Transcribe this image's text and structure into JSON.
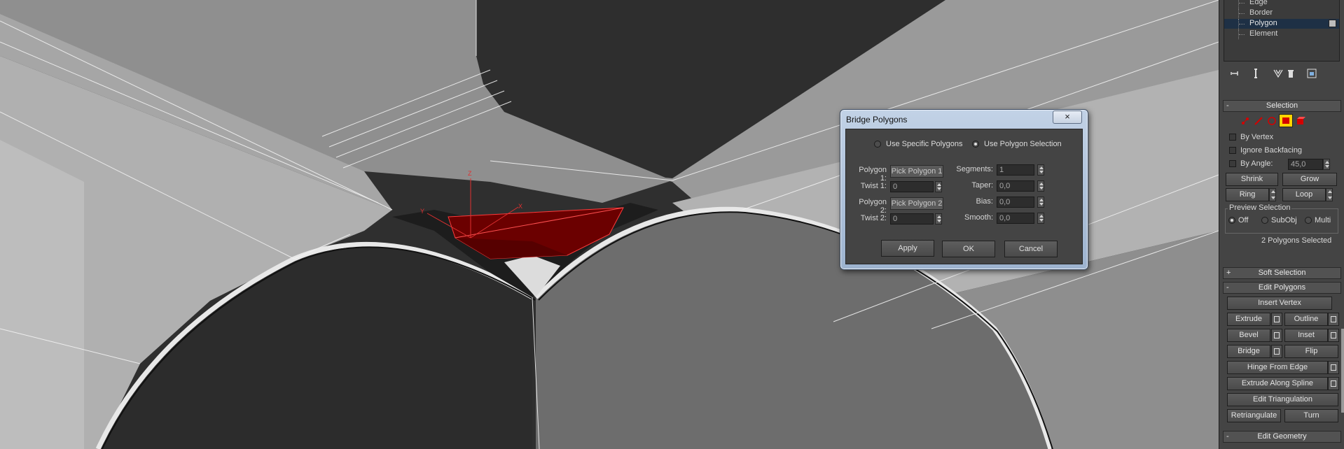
{
  "dialog": {
    "title": "Bridge Polygons",
    "close_label": "×",
    "radio_specific": "Use Specific Polygons",
    "radio_selection": "Use Polygon Selection",
    "polygon1_label": "Polygon 1:",
    "polygon1_button": "Pick Polygon 1",
    "twist1_label": "Twist 1:",
    "twist1_value": "0",
    "polygon2_label": "Polygon 2:",
    "polygon2_button": "Pick Polygon 2",
    "twist2_label": "Twist 2:",
    "twist2_value": "0",
    "segments_label": "Segments:",
    "segments_value": "1",
    "taper_label": "Taper:",
    "taper_value": "0,0",
    "bias_label": "Bias:",
    "bias_value": "0,0",
    "smooth_label": "Smooth:",
    "smooth_value": "0,0",
    "apply_label": "Apply",
    "ok_label": "OK",
    "cancel_label": "Cancel"
  },
  "viewport": {
    "gizmo_z": "Z",
    "gizmo_x": "X",
    "gizmo_y": "Y"
  },
  "panel": {
    "stack_items": [
      "Edge",
      "Border",
      "Polygon",
      "Element"
    ],
    "selected_stack_item": "Polygon",
    "selection_header": "Selection",
    "by_vertex": "By Vertex",
    "ignore_backfacing": "Ignore Backfacing",
    "by_angle": "By Angle:",
    "by_angle_value": "45,0",
    "shrink": "Shrink",
    "grow": "Grow",
    "ring": "Ring",
    "loop": "Loop",
    "preview_selection": "Preview Selection",
    "preview_off": "Off",
    "preview_subobj": "SubObj",
    "preview_multi": "Multi",
    "selected_count": "2 Polygons Selected",
    "soft_selection": "Soft Selection",
    "edit_polygons": "Edit Polygons",
    "insert_vertex": "Insert Vertex",
    "extrude": "Extrude",
    "outline": "Outline",
    "bevel": "Bevel",
    "inset": "Inset",
    "bridge": "Bridge",
    "flip": "Flip",
    "hinge_from_edge": "Hinge From Edge",
    "extrude_along_spline": "Extrude Along Spline",
    "edit_triangulation": "Edit Triangulation",
    "retriangulate": "Retriangulate",
    "turn": "Turn",
    "edit_geometry": "Edit Geometry",
    "minus": "-",
    "plus": "+"
  },
  "colors": {
    "highlight": "#6b0000",
    "accent_yellow": "#ffd400",
    "selection_red": "#d40000"
  }
}
